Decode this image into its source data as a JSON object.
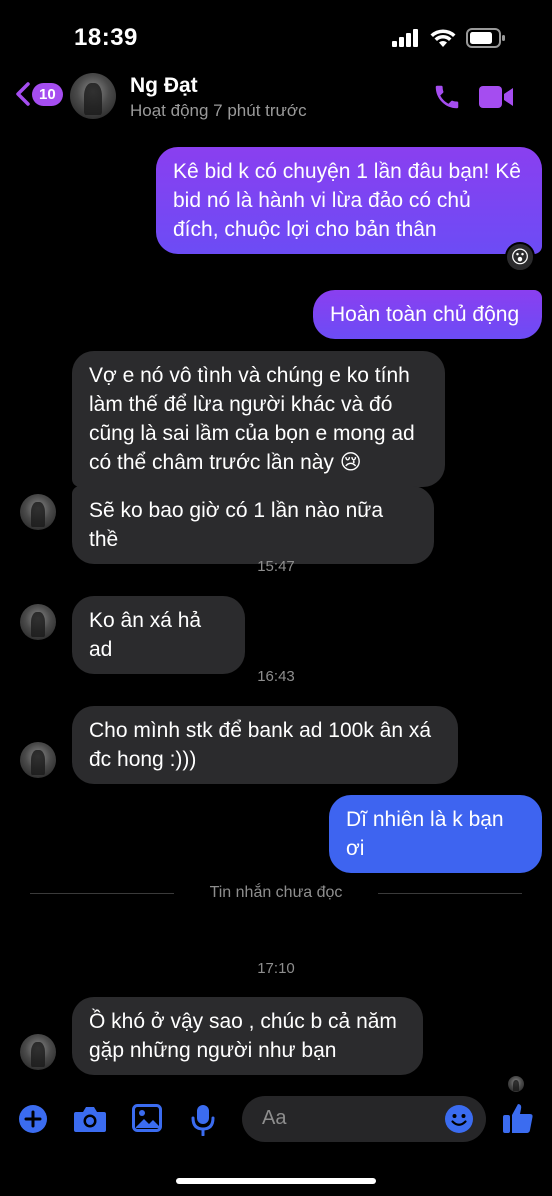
{
  "status_bar": {
    "time": "18:39"
  },
  "header": {
    "back_badge": "10",
    "contact_name": "Ng Đạt",
    "contact_status": "Hoạt động 7 phút trước"
  },
  "messages": [
    {
      "direction": "out",
      "lines": [
        "Kê bid k có chuyện 1 lần đâu bạn! Kê",
        "bid nó là hành vi lừa đảo có chủ",
        "đích, chuộc lợi cho bản thân"
      ],
      "reaction": "😮"
    },
    {
      "direction": "out",
      "lines": [
        "Hoàn toàn chủ động"
      ]
    },
    {
      "direction": "in",
      "lines": [
        "Vợ e nó vô tình và chúng e ko tính",
        "làm thế để lừa người khác và đó",
        "cũng là sai lầm của bọn e mong ad",
        "có thể châm trước lần này 😢"
      ]
    },
    {
      "direction": "in",
      "lines": [
        "Sẽ ko bao giờ có 1 lần nào nữa thề"
      ]
    },
    {
      "direction": "in",
      "lines": [
        "Ko ân xá hả ad"
      ]
    },
    {
      "direction": "in",
      "lines": [
        "Cho mình stk để bank ad 100k ân xá",
        "đc hong :)))"
      ]
    },
    {
      "direction": "out",
      "lines": [
        "Dĩ nhiên là k bạn ơi"
      ]
    },
    {
      "direction": "in",
      "lines": [
        "Ồ khó ở vậy sao , chúc b cả năm",
        "gặp những người như bạn"
      ]
    }
  ],
  "timestamps": [
    "15:47",
    "16:43",
    "17:10"
  ],
  "unread_divider": "Tin nhắn chưa đọc",
  "composer": {
    "placeholder": "Aa"
  },
  "colors": {
    "accent": "#a54df0",
    "outgoing_purple": "#7b45f2",
    "outgoing_blue": "#3e64f0",
    "incoming": "#2b2b2d"
  },
  "icons": [
    "chevron-left-icon",
    "phone-icon",
    "video-icon",
    "plus-icon",
    "camera-icon",
    "image-icon",
    "mic-icon",
    "smiley-icon",
    "thumbs-up-icon"
  ]
}
